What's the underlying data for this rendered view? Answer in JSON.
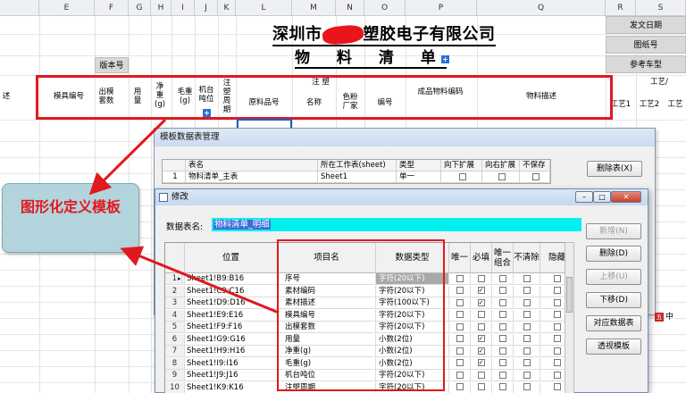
{
  "sheet": {
    "columns": [
      "E",
      "F",
      "G",
      "H",
      "I",
      "J",
      "K",
      "L",
      "M",
      "N",
      "O",
      "P",
      "Q",
      "R",
      "S"
    ],
    "company_prefix": "深圳市",
    "company_suffix": "塑胶电子有限公司",
    "subtitle": "物 料 清 单",
    "version_label": "版本号",
    "issue_date_label": "发文日期",
    "drawing_no_label": "图纸号",
    "ref_model_label": "参考车型",
    "partial_left_label": "述",
    "process_partial_label": "工艺/",
    "note_label": "注 塑",
    "headers": {
      "mold_no": "模具编号",
      "mold_sets": "出模套数",
      "usage": "用量",
      "net_weight": "净重(g)",
      "gross_weight": "毛重(g)",
      "machine_tonnage": "机台吨位",
      "injection_cycle": "注塑周期",
      "raw_material_no": "原料品号",
      "name": "名称",
      "color_vendor": "色粉厂家",
      "code": "编号",
      "finished_material_code": "成品物料编码",
      "material_desc": "物料描述",
      "process1": "工艺1",
      "process2": "工艺2",
      "process3": "工艺"
    }
  },
  "callout": {
    "text": "图形化定义模板"
  },
  "template_window": {
    "title": "模板数据表管理",
    "columns": [
      "表名",
      "所在工作表(sheet)",
      "类型",
      "向下扩展",
      "向右扩展",
      "不保存"
    ],
    "rows": [
      {
        "num": "1",
        "name": "物料清单_主表",
        "sheet": "Sheet1",
        "type": "单一"
      }
    ],
    "buttons": {
      "delete_table": "删除表(X)"
    }
  },
  "edit_window": {
    "title": "修改",
    "dataset_label": "数据表名:",
    "dataset_value": "物料清单_明细",
    "columns": {
      "position": "位置",
      "item_name": "项目名",
      "data_type": "数据类型",
      "unique": "唯一",
      "required": "必填",
      "unique_combo": "唯一组合",
      "no_clear": "不清除",
      "hidden": "隐藏"
    },
    "rows": [
      {
        "num": "1",
        "pos": "Sheet1!B9:B16",
        "item": "序号",
        "dtype": "字符(20以下)",
        "req": false
      },
      {
        "num": "2",
        "pos": "Sheet1!C9:C16",
        "item": "素材编码",
        "dtype": "字符(20以下)",
        "req": true
      },
      {
        "num": "3",
        "pos": "Sheet1!D9:D16",
        "item": "素材描述",
        "dtype": "字符(100以下)",
        "req": true
      },
      {
        "num": "4",
        "pos": "Sheet1!E9:E16",
        "item": "模具编号",
        "dtype": "字符(20以下)",
        "req": false
      },
      {
        "num": "5",
        "pos": "Sheet1!F9:F16",
        "item": "出模套数",
        "dtype": "字符(20以下)",
        "req": false
      },
      {
        "num": "6",
        "pos": "Sheet1!G9:G16",
        "item": "用量",
        "dtype": "小数(2位)",
        "req": true
      },
      {
        "num": "7",
        "pos": "Sheet1!H9:H16",
        "item": "净重(g)",
        "dtype": "小数(2位)",
        "req": true
      },
      {
        "num": "8",
        "pos": "Sheet1!I9:I16",
        "item": "毛重(g)",
        "dtype": "小数(2位)",
        "req": true
      },
      {
        "num": "9",
        "pos": "Sheet1!J9:J16",
        "item": "机台吨位",
        "dtype": "字符(20以下)",
        "req": false
      },
      {
        "num": "10",
        "pos": "Sheet1!K9:K16",
        "item": "注塑周期",
        "dtype": "字符(20以下)",
        "req": false
      }
    ],
    "buttons": {
      "add": "新增(N)",
      "delete": "删除(D)",
      "move_up": "上移(U)",
      "move_down": "下移(D)",
      "map_dataset": "对应数据表",
      "pivot_template": "透视模板"
    }
  },
  "ime": {
    "label": "中"
  },
  "colors": {
    "accent_red": "#e0191e",
    "selection_blue": "#3a6fd8",
    "cyan": "#00f0f0",
    "callout_bg": "#b3d3dd"
  }
}
